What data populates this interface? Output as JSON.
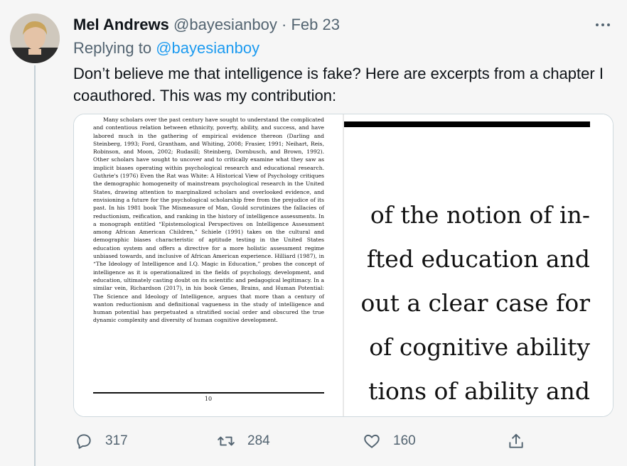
{
  "tweet": {
    "author_name": "Mel Andrews",
    "author_handle": "@bayesianboy",
    "separator": "·",
    "date": "Feb 23",
    "replying_prefix": "Replying to",
    "replying_handle": "@bayesianboy",
    "text": "Don’t believe me that intelligence is fake? Here are excerpts from a chapter I coauthored. This was my contribution:"
  },
  "media": {
    "left_page_text": "Many scholars over the past century have sought to understand the complicated and contentious relation between ethnicity, poverty, ability, and success, and have labored much in the gathering of empirical evidence thereon (Darling and Steinberg, 1993; Ford, Grantham, and Whiting, 2008; Frasier, 1991; Neihart, Reis, Robinson, and Moon, 2002; Rudasill; Steinberg, Dornbusch, and Brown, 1992). Other scholars have sought to uncover and to critically examine what they saw as implicit biases operating within psychological research and educational research. Guthrie's (1976) Even the Rat was White: A Historical View of Psychology critiques the demographic homogeneity of mainstream psychological research in the United States, drawing attention to marginalized scholars and overlooked evidence, and envisioning a future for the psychological scholarship free from the prejudice of its past. In his 1981 book The Mismeasure of Man, Gould scrutinizes the fallacies of reductionism, reification, and ranking in the history of intelligence assessments. In a monograph entitled “Epistemological Perspectives on Intelligence Assessment among African American Children,” Schiele (1991) takes on the cultural and demographic biases characteristic of aptitude testing in the United States education system and offers a directive for a more holistic assessment regime unbiased towards, and inclusive of African American experience. Hilliard (1987), in “The Ideology of Intelligence and I.Q. Magic in Education,” probes the concept of intelligence as it is operationalized in the fields of psychology, development, and education, ultimately casting doubt on its scientific and pedagogical legitimacy. In a similar vein, Richardson (2017), in his book Genes, Brains, and Human Potential: The Science and Ideology of Intelligence, argues that more than a century of wanton reductionism and definitional vagueness in the study of intelligence and human potential has perpetuated a stratified social order and obscured the true dynamic complexity and diversity of human cognitive development.",
    "page_number": "10",
    "zoom_lines": [
      "of the notion of in-",
      "fted education and",
      "out a clear case for",
      "of cognitive ability",
      "tions of ability and"
    ]
  },
  "actions": {
    "reply_count": "317",
    "retweet_count": "284",
    "like_count": "160"
  }
}
